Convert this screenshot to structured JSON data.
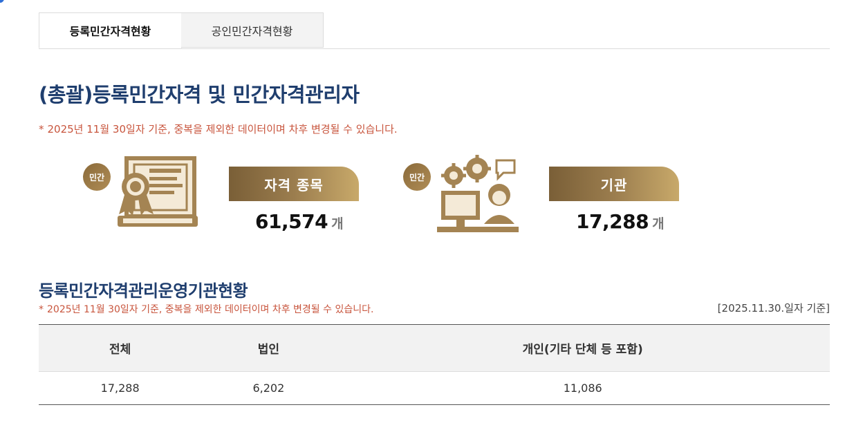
{
  "tabs": [
    {
      "label": "등록민간자격현황",
      "active": true
    },
    {
      "label": "공인민간자격현황",
      "active": false
    }
  ],
  "summary": {
    "title": "(총괄)등록민간자격 및 민간자격관리자",
    "note_star": "*",
    "note": "2025년 11월 30일자 기준, 중복을 제외한 데이터이며 차후 변경될 수 있습니다."
  },
  "stats": [
    {
      "badge": "민간",
      "label": "자격 종목",
      "value": "61,574",
      "unit": "개",
      "icon": "certificate-icon"
    },
    {
      "badge": "민간",
      "label": "기관",
      "value": "17,288",
      "unit": "개",
      "icon": "office-worker-icon"
    }
  ],
  "operators": {
    "title": "등록민간자격관리운영기관현황",
    "note_star": "*",
    "note": "2025년 11월 30일자 기준, 중복을 제외한 데이터이며 차후 변경될 수 있습니다.",
    "basis": "[2025.11.30.일자 기준]",
    "headers": [
      "전체",
      "법인",
      "개인(기타 단체 등 포함)"
    ],
    "row": [
      "17,288",
      "6,202",
      "11,086"
    ]
  },
  "colors": {
    "title": "#1f3e6e",
    "note": "#c8553d",
    "gold_dark": "#7a5f37",
    "gold_light": "#c8a96a"
  }
}
